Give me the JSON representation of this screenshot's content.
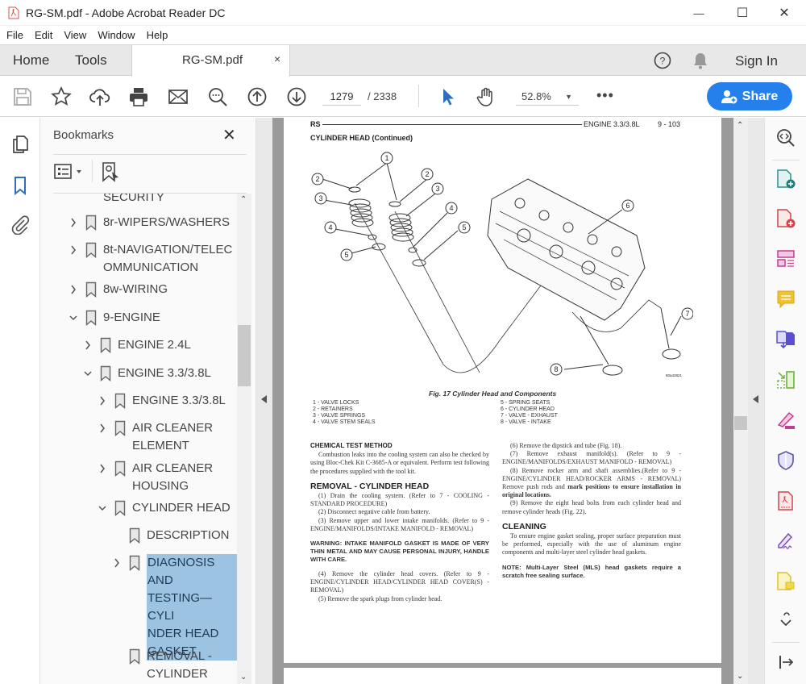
{
  "window": {
    "title": "RG-SM.pdf - Adobe Acrobat Reader DC",
    "controls": {
      "minimize": "—",
      "maximize": "☐",
      "close": "✕"
    }
  },
  "menu": {
    "items": [
      {
        "label": "File",
        "accel": "F"
      },
      {
        "label": "Edit",
        "accel": "E"
      },
      {
        "label": "View",
        "accel": "V"
      },
      {
        "label": "Window",
        "accel": "W"
      },
      {
        "label": "Help",
        "accel": "H"
      }
    ]
  },
  "tabs": {
    "home": "Home",
    "tools": "Tools",
    "document": "RG-SM.pdf",
    "close_glyph": "×",
    "sign_in": "Sign In"
  },
  "toolbar": {
    "page_current": "1279",
    "page_total": "/ 2338",
    "zoom": "52.8%",
    "zoom_caret": "▼",
    "more": "•••",
    "share": "Share",
    "icons": [
      "save-icon",
      "bookmark-star-icon",
      "upload-cloud-icon",
      "print-icon",
      "email-icon",
      "search-zoom-icon",
      "page-up-icon",
      "page-down-icon",
      "select-cursor-icon",
      "hand-tool-icon"
    ]
  },
  "left_rail": {
    "icons": [
      "page-thumbnails-icon",
      "bookmarks-icon",
      "attachments-icon"
    ],
    "active": "bookmarks-icon"
  },
  "bookmarks": {
    "title": "Bookmarks",
    "close": "✕",
    "items": [
      {
        "label": "SECURITY",
        "level": 1,
        "expander": "none",
        "partial": true
      },
      {
        "label": "8r-WIPERS/WASHERS",
        "level": 1,
        "expander": "collapsed"
      },
      {
        "label": "8t-NAVIGATION/TELEC\nOMMUNICATION",
        "level": 1,
        "expander": "collapsed"
      },
      {
        "label": "8w-WIRING",
        "level": 1,
        "expander": "collapsed"
      },
      {
        "label": "9-ENGINE",
        "level": 1,
        "expander": "expanded"
      },
      {
        "label": "ENGINE 2.4L",
        "level": 2,
        "expander": "collapsed"
      },
      {
        "label": "ENGINE 3.3/3.8L",
        "level": 2,
        "expander": "expanded"
      },
      {
        "label": "ENGINE 3.3/3.8L",
        "level": 3,
        "expander": "collapsed"
      },
      {
        "label": "AIR CLEANER\nELEMENT",
        "level": 3,
        "expander": "collapsed"
      },
      {
        "label": "AIR CLEANER\nHOUSING",
        "level": 3,
        "expander": "collapsed"
      },
      {
        "label": "CYLINDER HEAD",
        "level": 3,
        "expander": "expanded"
      },
      {
        "label": "DESCRIPTION",
        "level": 4,
        "expander": "none"
      },
      {
        "label": "DIAGNOSIS\nAND\nTESTING—CYLI\nNDER HEAD\nGASKET",
        "level": 4,
        "expander": "collapsed",
        "selected": true
      },
      {
        "label": "REMOVAL -\nCYLINDER",
        "level": 4,
        "expander": "none"
      }
    ],
    "scroll_up": "^",
    "scroll_down": "v"
  },
  "page": {
    "header_left": "RS",
    "header_right": "ENGINE 3.3/3.8L",
    "page_number": "9 - 103",
    "section_title": "CYLINDER HEAD (Continued)",
    "figure": {
      "callouts": [
        "1",
        "2",
        "3",
        "4",
        "5",
        "6",
        "7",
        "8"
      ],
      "art_id": "80a42821",
      "caption": "Fig. 17 Cylinder Head and Components",
      "legend_left": "1 - VALVE LOCKS\n2 - RETAINERS\n3 - VALVE SPRINGS\n4 - VALVE STEM SEALS",
      "legend_right": "5 - SPRING SEATS\n6 - CYLINDER HEAD\n7 - VALVE - EXHAUST\n8 - VALVE - INTAKE"
    },
    "left_col": {
      "chem_heading": "CHEMICAL TEST METHOD",
      "chem_body": "Combustion leaks into the cooling system can also be checked by using Bloc-Chek Kit C-3685-A or equivalent. Perform test following the procedures supplied with the tool kit.",
      "removal_heading": "REMOVAL - CYLINDER HEAD",
      "step1": "(1) Drain the cooling system. (Refer to 7 - COOLING - STANDARD PROCEDURE)",
      "step2": "(2) Disconnect negative cable from battery.",
      "step3": "(3) Remove upper and lower intake manifolds. (Refer to 9 - ENGINE/MANIFOLDS/INTAKE MANIFOLD - REMOVAL)",
      "warning": "WARNING: INTAKE MANIFOLD GASKET IS MADE OF VERY THIN METAL AND MAY CAUSE PERSONAL INJURY, HANDLE WITH CARE.",
      "step4": "(4) Remove the cylinder head covers. (Refer to 9 - ENGINE/CYLINDER HEAD/CYLINDER HEAD COVER(S) - REMOVAL)",
      "step5": "(5) Remove the spark plugs from cylinder head."
    },
    "right_col": {
      "step6": "(6) Remove the dipstick and tube (Fig. 18).",
      "step7": "(7) Remove exhaust manifold(s). (Refer to 9 - ENGINE/MANIFOLDS/EXHAUST MANIFOLD - REMOVAL)",
      "step8_a": "(8) Remove rocker arm and shaft assemblies.(Refer to 9 - ENGINE/CYLINDER HEAD/ROCKER ARMS - REMOVAL) Remove push rods and ",
      "step8_b": "mark positions to ensure installation in original locations.",
      "step9": "(9) Remove the eight head bolts from each cylinder head and remove cylinder heads (Fig. 22).",
      "cleaning_heading": "CLEANING",
      "cleaning_body": "To ensure engine gasket sealing, proper surface preparation must be performed, especially with the use of aluminum engine components and multi-layer steel cylinder head gaskets.",
      "note": "NOTE: Multi-Layer Steel (MLS) head gaskets require a scratch free sealing surface."
    }
  },
  "right_rail": {
    "icons": [
      "zoom-search-icon",
      "create-pdf-icon",
      "export-pdf-icon",
      "organize-pages-icon",
      "comment-icon",
      "combine-files-icon",
      "compress-pdf-icon",
      "fill-sign-icon",
      "protect-icon",
      "pdf-standards-icon",
      "request-signature-icon",
      "send-for-review-icon",
      "more-tools-icon",
      "collapse-panel-icon"
    ]
  },
  "colors": {
    "accent": "#2680eb",
    "selection": "#9cc3e2",
    "doc_background": "#9a9a9a"
  }
}
